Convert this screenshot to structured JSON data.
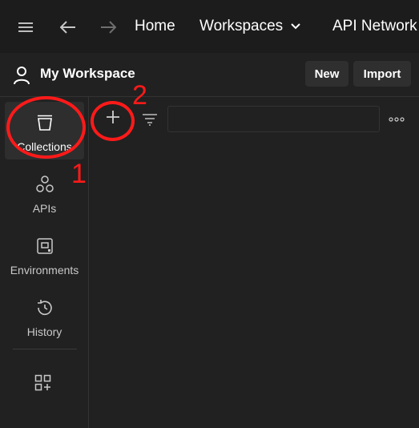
{
  "topbar": {
    "nav": {
      "home": "Home",
      "workspaces": "Workspaces",
      "api_network": "API Network"
    }
  },
  "workspace": {
    "title": "My Workspace",
    "new_label": "New",
    "import_label": "Import"
  },
  "sidebar": {
    "items": [
      {
        "label": "Collections",
        "icon": "collections-icon",
        "active": true
      },
      {
        "label": "APIs",
        "icon": "apis-icon",
        "active": false
      },
      {
        "label": "Environments",
        "icon": "environments-icon",
        "active": false
      },
      {
        "label": "History",
        "icon": "history-icon",
        "active": false
      }
    ]
  },
  "annotations": {
    "step1": "1",
    "step2": "2",
    "color": "#ff1a1a"
  },
  "theme": {
    "background": "#212121",
    "topbar": "#1c1c1c",
    "button": "#2f2f2f"
  }
}
